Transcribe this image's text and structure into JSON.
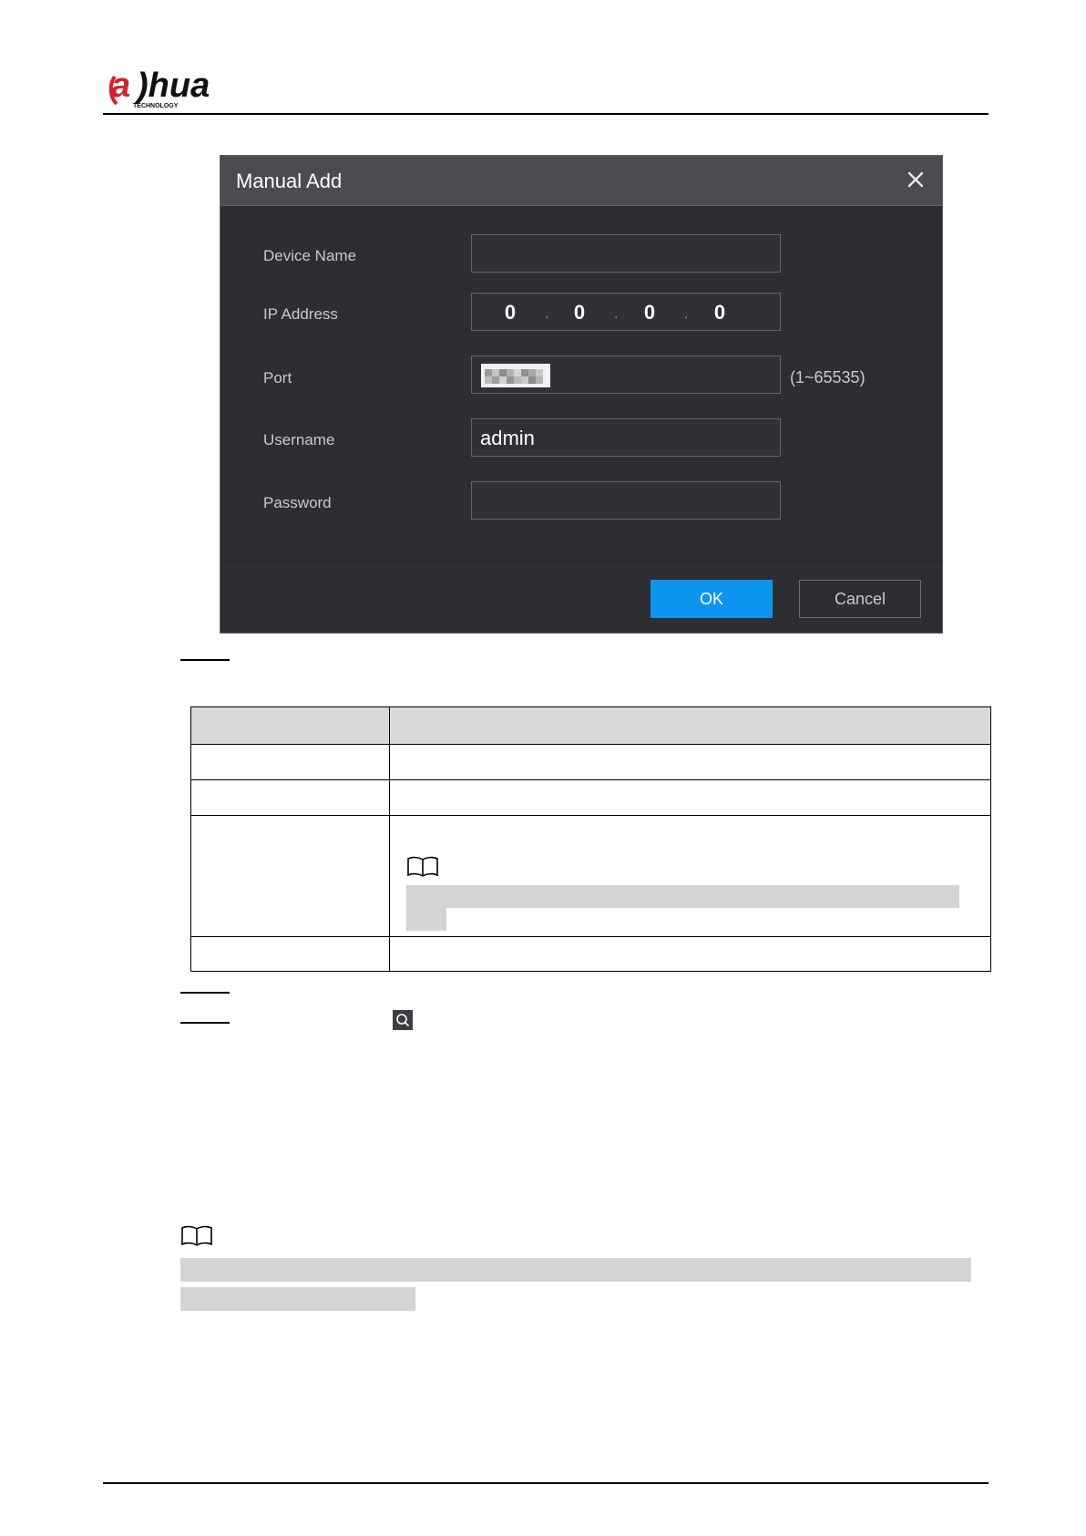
{
  "header": {
    "brand_text": "alhua",
    "brand_subtext": "TECHNOLOGY"
  },
  "dialog": {
    "title": "Manual Add",
    "close_icon": "close-icon",
    "fields": [
      {
        "label": "Device Name",
        "value": ""
      },
      {
        "label": "IP Address",
        "octets": [
          "0",
          "0",
          "0",
          "0"
        ]
      },
      {
        "label": "Port",
        "value": "",
        "hint": "(1~65535)"
      },
      {
        "label": "Username",
        "value": "admin"
      },
      {
        "label": "Password",
        "value": ""
      }
    ],
    "ok_label": "OK",
    "cancel_label": "Cancel"
  },
  "icons": {
    "note": "book-note-icon",
    "search": "search-icon"
  },
  "colors": {
    "dialog_bg": "#2c2e33",
    "dialog_header": "#4a4c51",
    "ok_button": "#0b95f0"
  }
}
